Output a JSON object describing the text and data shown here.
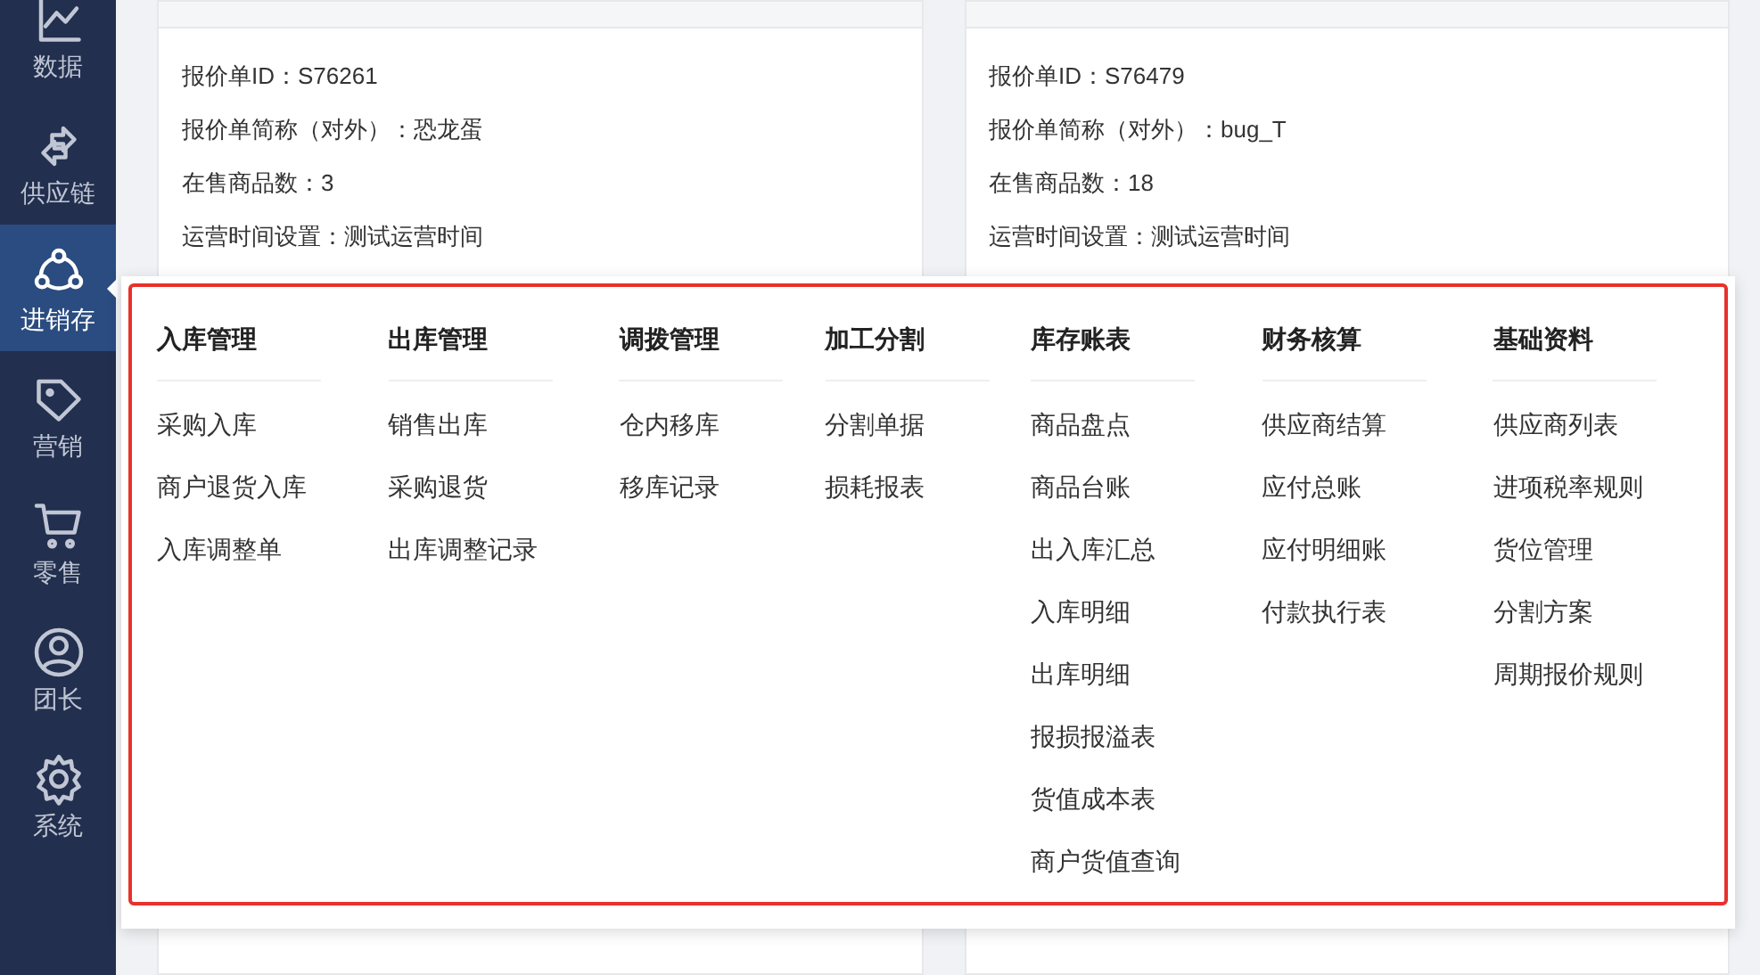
{
  "sidebar": {
    "items": [
      {
        "label": "数据",
        "selected": false
      },
      {
        "label": "供应链",
        "selected": false
      },
      {
        "label": "进销存",
        "selected": true
      },
      {
        "label": "营销",
        "selected": false
      },
      {
        "label": "零售",
        "selected": false
      },
      {
        "label": "团长",
        "selected": false
      },
      {
        "label": "系统",
        "selected": false
      }
    ]
  },
  "cards": [
    {
      "lines": [
        "报价单ID：S76261",
        "报价单简称（对外）：恐龙蛋",
        "在售商品数：3",
        "运营时间设置：测试运营时间"
      ]
    },
    {
      "lines": [
        "报价单ID：S76479",
        "报价单简称（对外）：bug_T",
        "在售商品数：18",
        "运营时间设置：测试运营时间"
      ]
    }
  ],
  "menu": {
    "columns": [
      {
        "title": "入库管理",
        "items": [
          "采购入库",
          "商户退货入库",
          "入库调整单"
        ]
      },
      {
        "title": "出库管理",
        "items": [
          "销售出库",
          "采购退货",
          "出库调整记录"
        ]
      },
      {
        "title": "调拨管理",
        "items": [
          "仓内移库",
          "移库记录"
        ]
      },
      {
        "title": "加工分割",
        "items": [
          "分割单据",
          "损耗报表"
        ]
      },
      {
        "title": "库存账表",
        "items": [
          "商品盘点",
          "商品台账",
          "出入库汇总",
          "入库明细",
          "出库明细",
          "报损报溢表",
          "货值成本表",
          "商户货值查询"
        ]
      },
      {
        "title": "财务核算",
        "items": [
          "供应商结算",
          "应付总账",
          "应付明细账",
          "付款执行表"
        ]
      },
      {
        "title": "基础资料",
        "items": [
          "供应商列表",
          "进项税率规则",
          "货位管理",
          "分割方案",
          "周期报价规则"
        ]
      }
    ]
  }
}
